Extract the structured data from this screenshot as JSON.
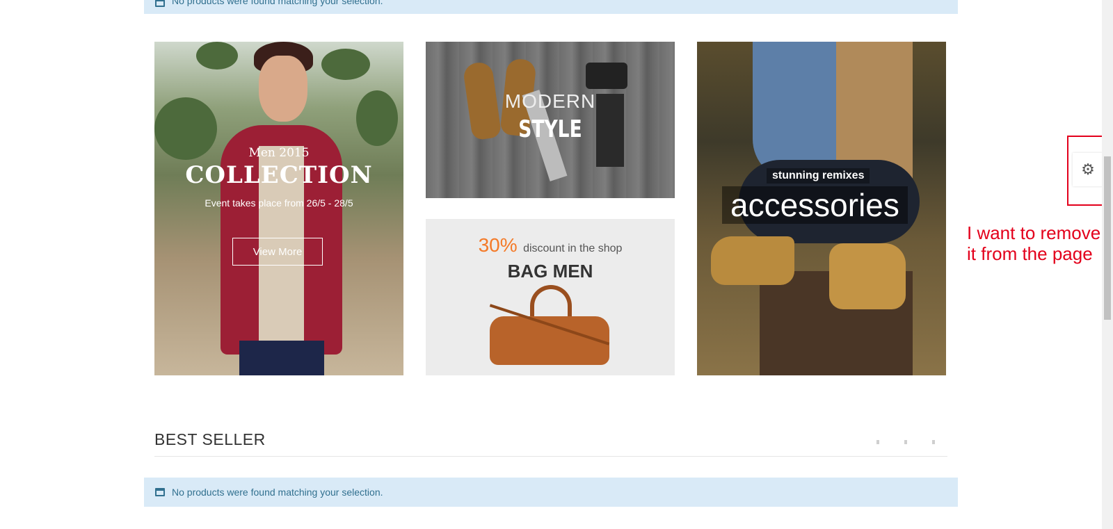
{
  "notices": {
    "top": "No products were found matching your selection.",
    "bottom": "No products were found matching your selection."
  },
  "banner_men": {
    "subtitle": "Men 2015",
    "title": "COLLECTION",
    "event": "Event takes place from 26/5 - 28/5",
    "button": "View More"
  },
  "banner_style": {
    "line1": "MODERN",
    "line2": "STYLE"
  },
  "banner_bag": {
    "percent": "30%",
    "discount": "discount in the shop",
    "title": "BAG MEN"
  },
  "banner_accessories": {
    "subtitle": "stunning remixes",
    "title": "accessories"
  },
  "best_seller": {
    "title": "BEST SELLER"
  },
  "settings": {
    "icon": "gear-icon",
    "glyph": "⚙"
  },
  "annotation": {
    "text": "I want to remove it from the page",
    "color": "#e3001b"
  },
  "colors": {
    "notice_bg": "#d9eaf7",
    "notice_text": "#31708f",
    "accent_orange": "#f47a28"
  }
}
